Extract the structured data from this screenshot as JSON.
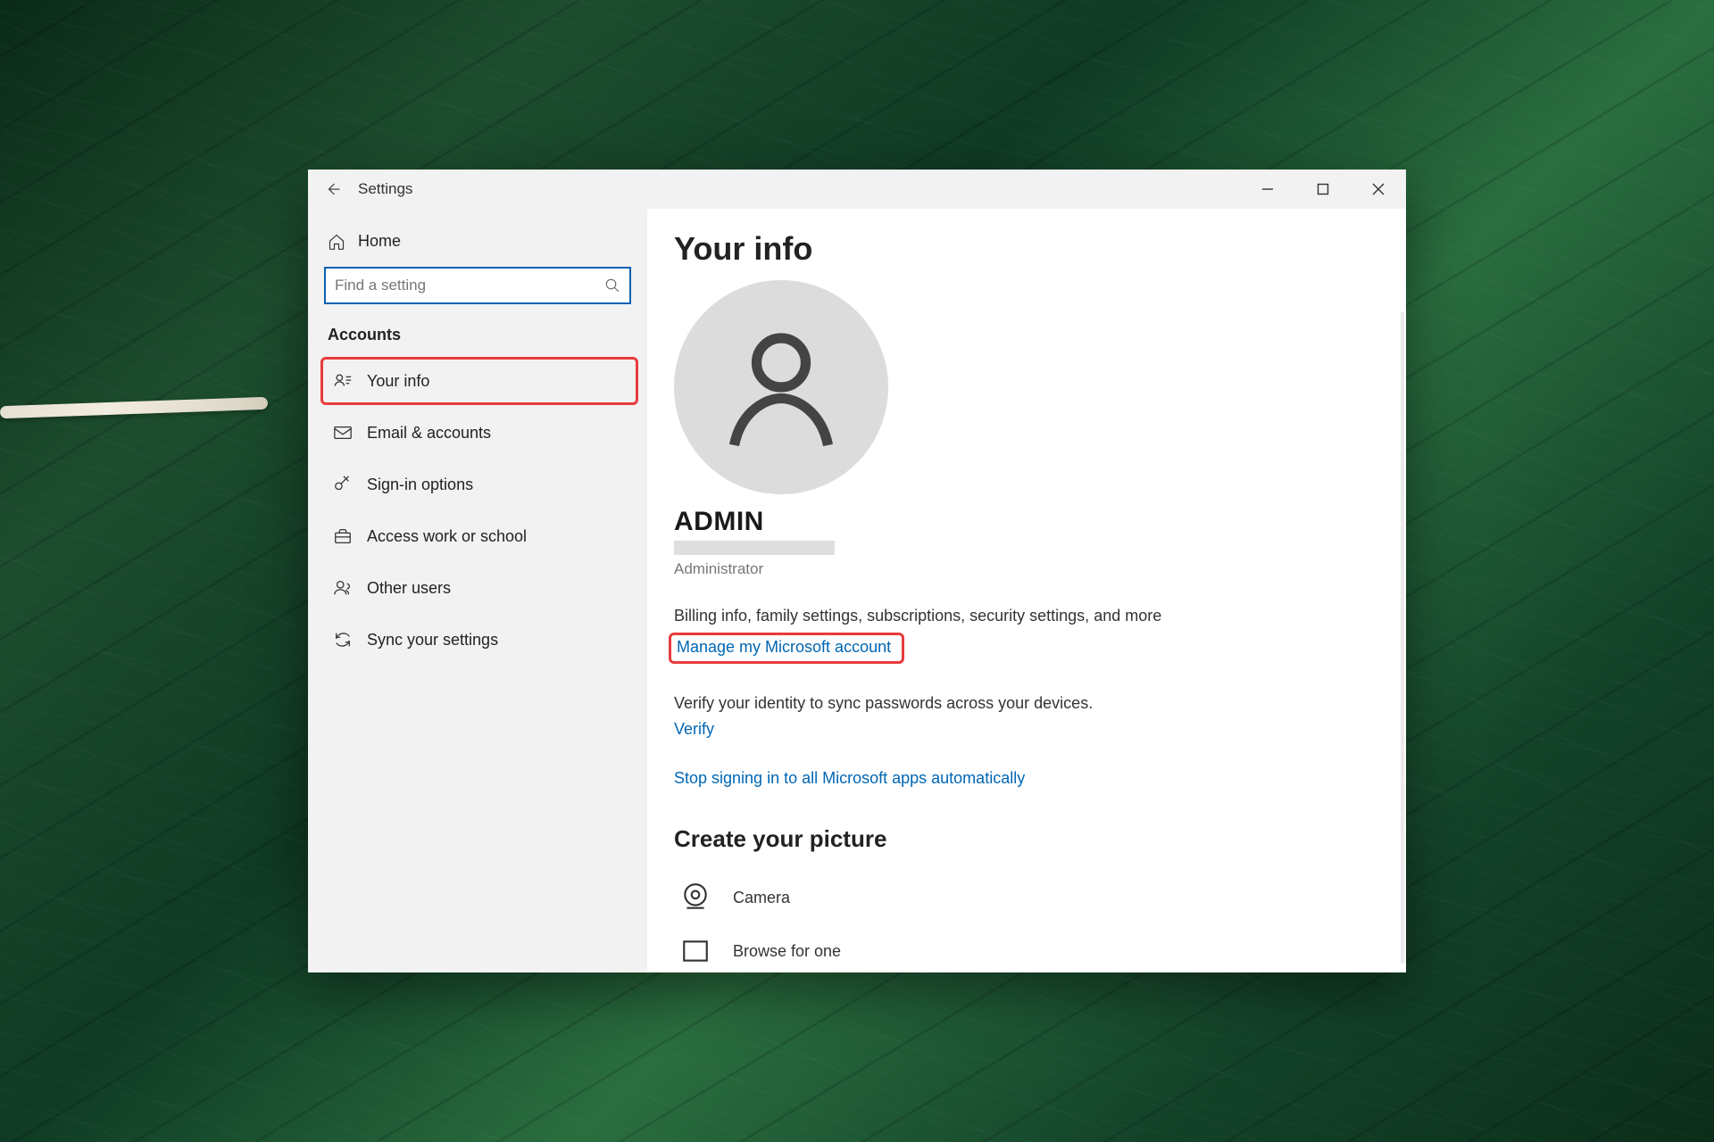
{
  "window": {
    "title": "Settings"
  },
  "sidebar": {
    "home": "Home",
    "search_placeholder": "Find a setting",
    "section": "Accounts",
    "items": [
      {
        "label": "Your info"
      },
      {
        "label": "Email & accounts"
      },
      {
        "label": "Sign-in options"
      },
      {
        "label": "Access work or school"
      },
      {
        "label": "Other users"
      },
      {
        "label": "Sync your settings"
      }
    ]
  },
  "main": {
    "heading": "Your info",
    "username": "ADMIN",
    "role": "Administrator",
    "billing_para": "Billing info, family settings, subscriptions, security settings, and more",
    "manage_link": "Manage my Microsoft account",
    "verify_para": "Verify your identity to sync passwords across your devices.",
    "verify_link": "Verify",
    "stop_signin_link": "Stop signing in to all Microsoft apps automatically",
    "picture_heading": "Create your picture",
    "camera_label": "Camera",
    "browse_label": "Browse for one"
  }
}
